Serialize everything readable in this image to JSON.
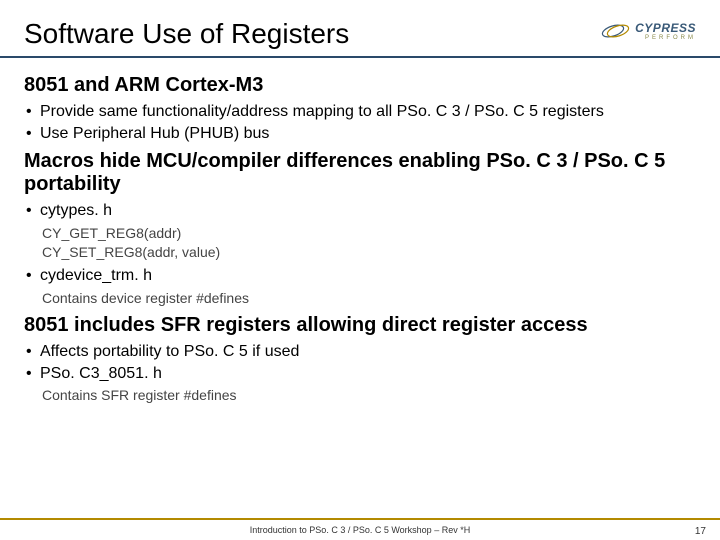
{
  "title": "Software Use of Registers",
  "logo": {
    "main": "CYPRESS",
    "sub": "PERFORM"
  },
  "section1": {
    "heading": "8051 and ARM Cortex-M3",
    "bullets": [
      "Provide same functionality/address mapping to all PSo. C 3 / PSo. C 5 registers",
      "Use Peripheral Hub (PHUB) bus"
    ]
  },
  "section2": {
    "heading": "Macros hide MCU/compiler differences enabling PSo. C 3 / PSo. C 5 portability",
    "items": [
      {
        "bullet": "cytypes. h",
        "sub": [
          "CY_GET_REG8(addr)",
          "CY_SET_REG8(addr, value)"
        ]
      },
      {
        "bullet": "cydevice_trm. h",
        "sub": [
          "Contains device register #defines"
        ]
      }
    ]
  },
  "section3": {
    "heading": "8051 includes SFR registers allowing direct register access",
    "bullets": [
      "Affects portability to PSo. C 5 if used",
      "PSo. C3_8051. h"
    ],
    "sub": [
      "Contains SFR register #defines"
    ]
  },
  "footer": "Introduction to PSo. C 3 / PSo. C 5 Workshop – Rev *H",
  "page": "17"
}
